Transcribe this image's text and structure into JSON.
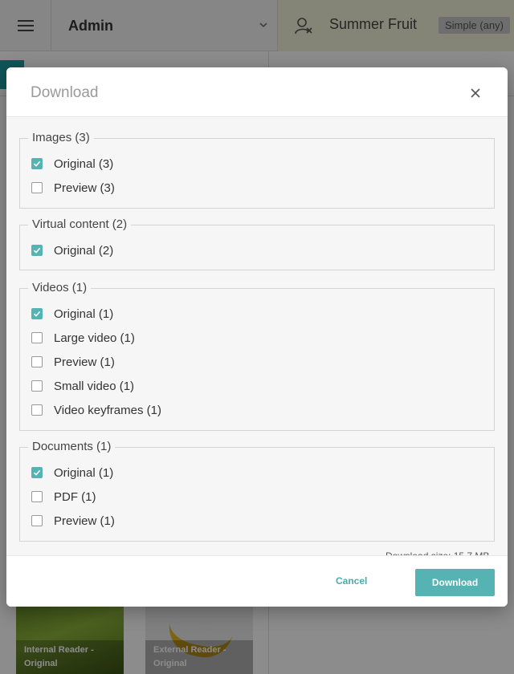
{
  "header": {
    "section_select": "Admin",
    "user_name": "Summer Fruit",
    "mode_badge": "Simple (any)"
  },
  "thumbnails": [
    {
      "caption_line1": "Internal Reader -",
      "caption_line2": "Original"
    },
    {
      "caption_line1": "External Reader -",
      "caption_line2": "Original"
    }
  ],
  "dialog": {
    "title": "Download",
    "groups": [
      {
        "legend": "Images (3)",
        "options": [
          {
            "label": "Original (3)",
            "checked": true
          },
          {
            "label": "Preview (3)",
            "checked": false
          }
        ]
      },
      {
        "legend": "Virtual content (2)",
        "options": [
          {
            "label": "Original (2)",
            "checked": true
          }
        ]
      },
      {
        "legend": "Videos (1)",
        "options": [
          {
            "label": "Original (1)",
            "checked": true
          },
          {
            "label": "Large video (1)",
            "checked": false
          },
          {
            "label": "Preview (1)",
            "checked": false
          },
          {
            "label": "Small video (1)",
            "checked": false
          },
          {
            "label": "Video keyframes (1)",
            "checked": false
          }
        ]
      },
      {
        "legend": "Documents (1)",
        "options": [
          {
            "label": "Original (1)",
            "checked": true
          },
          {
            "label": "PDF (1)",
            "checked": false
          },
          {
            "label": "Preview (1)",
            "checked": false
          }
        ]
      }
    ],
    "download_size": "Download size: 15.7 MB",
    "cancel_label": "Cancel",
    "download_label": "Download"
  },
  "colors": {
    "accent": "#55b3b4",
    "teal_chip": "#1a9ba1",
    "user_area_bg": "#f1f1d9"
  },
  "icons": [
    "menu-icon",
    "chevron-down-icon",
    "user-remove-icon",
    "close-icon",
    "check-icon"
  ]
}
